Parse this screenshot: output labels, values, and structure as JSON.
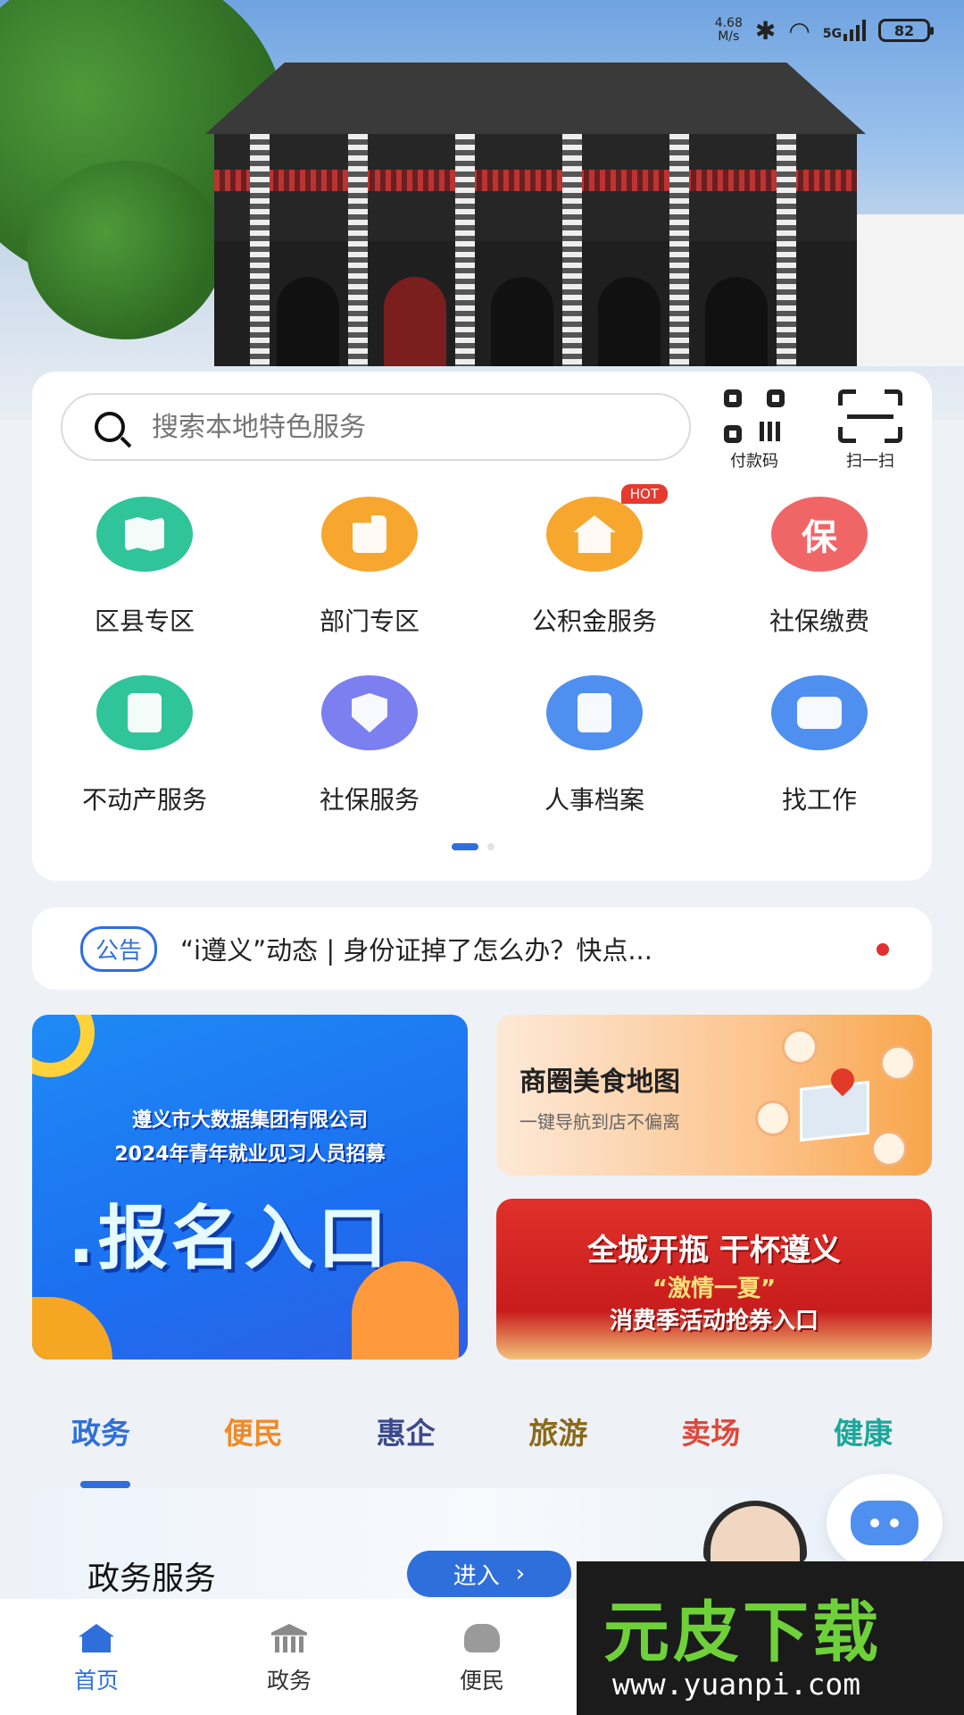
{
  "status_bar": {
    "net_speed": "4.68",
    "net_unit": "M/s",
    "network": "5G",
    "battery": "82"
  },
  "search": {
    "placeholder": "搜索本地特色服务"
  },
  "top_actions": {
    "pay_code": "付款码",
    "scan": "扫一扫"
  },
  "services": [
    {
      "label": "区县专区",
      "icon": "map-icon",
      "color": "#2fc49a"
    },
    {
      "label": "部门专区",
      "icon": "building-icon",
      "color": "#f7a62e"
    },
    {
      "label": "公积金服务",
      "icon": "house-yen-icon",
      "color": "#f7a62e",
      "badge": "HOT"
    },
    {
      "label": "社保缴费",
      "icon": "bao-icon",
      "color": "#f06666",
      "glyph": "保"
    },
    {
      "label": "不动产服务",
      "icon": "document-icon",
      "color": "#2fc49a"
    },
    {
      "label": "社保服务",
      "icon": "shield-search-icon",
      "color": "#7b7ff0"
    },
    {
      "label": "人事档案",
      "icon": "archive-icon",
      "color": "#4f8ff0"
    },
    {
      "label": "找工作",
      "icon": "briefcase-icon",
      "color": "#4f8ff0"
    }
  ],
  "pager": {
    "active_index": 0,
    "count": 2
  },
  "notice": {
    "tag": "公告",
    "text": "“i遵义”动态 | 身份证掉了怎么办？快点..."
  },
  "banners": {
    "recruit": {
      "line1": "遵义市大数据集团有限公司",
      "line2": "2024年青年就业见习人员招募",
      "headline": ".报名入口"
    },
    "food_map": {
      "title": "商圈美食地图",
      "subtitle": "一键导航到店不偏离"
    },
    "promo": {
      "line1": "全城开瓶 干杯遵义",
      "line2": "“激情一夏”",
      "line3": "消费季活动抢券入口"
    }
  },
  "category_tabs": [
    {
      "label": "政务",
      "color": "#2f6fdc",
      "active": true
    },
    {
      "label": "便民",
      "color": "#f08a24"
    },
    {
      "label": "惠企",
      "color": "#3a4a8a"
    },
    {
      "label": "旅游",
      "color": "#8a6a1a"
    },
    {
      "label": "卖场",
      "color": "#e0483a"
    },
    {
      "label": "健康",
      "color": "#1aa89a"
    }
  ],
  "panel": {
    "title": "政务服务",
    "enter_label": "进入"
  },
  "bottom_nav": [
    {
      "label": "首页",
      "icon": "home-icon",
      "active": true
    },
    {
      "label": "政务",
      "icon": "government-icon"
    },
    {
      "label": "便民",
      "icon": "handshake-icon"
    }
  ],
  "watermark": {
    "brand": "元皮下载",
    "url": "www.yuanpi.com"
  }
}
